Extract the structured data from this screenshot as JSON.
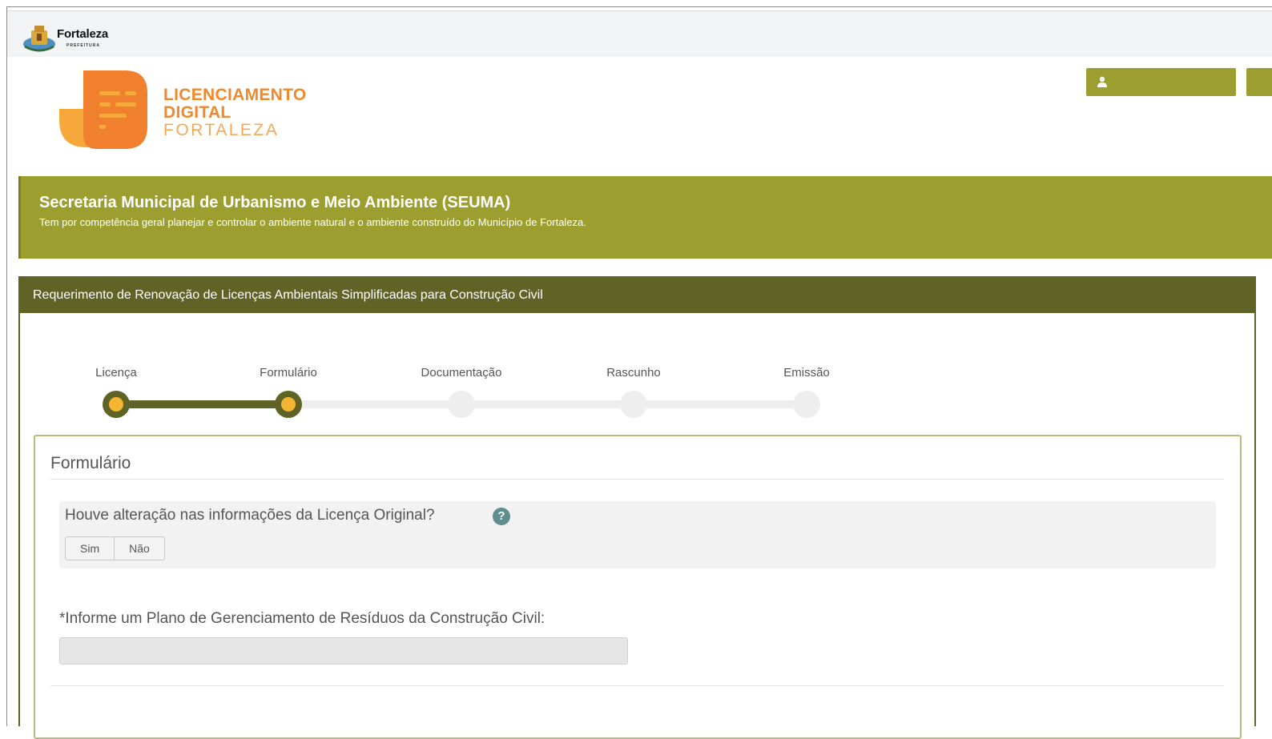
{
  "header": {
    "city_name": "Fortaleza",
    "city_subtitle": "PREFEITURA",
    "brand_line1": "LICENCIAMENTO",
    "brand_line2": "DIGITAL",
    "brand_line3": "FORTALEZA",
    "user_button_label": "",
    "extra_button_label": ""
  },
  "banner": {
    "title": "Secretaria Municipal de Urbanismo e Meio Ambiente (SEUMA)",
    "subtitle": "Tem por competência geral planejar e controlar o ambiente natural e o ambiente construído do Município de Fortaleza."
  },
  "panel": {
    "title": "Requerimento de Renovação de Licenças Ambientais Simplificadas para Construção Civil"
  },
  "steps": [
    {
      "label": "Licença",
      "status": "done"
    },
    {
      "label": "Formulário",
      "status": "current"
    },
    {
      "label": "Documentação",
      "status": "pending"
    },
    {
      "label": "Rascunho",
      "status": "pending"
    },
    {
      "label": "Emissão",
      "status": "pending"
    }
  ],
  "form": {
    "heading": "Formulário",
    "question": "Houve alteração nas informações da Licença Original?",
    "help_icon_glyph": "?",
    "option_yes": "Sim",
    "option_no": "Não",
    "field_label": "*Informe um Plano de Gerenciamento de Resíduos da Construção Civil:",
    "field_value": "",
    "field_placeholder": ""
  },
  "colors": {
    "olive": "#9c9f30",
    "dark_olive": "#5f6326",
    "orange": "#f0892e",
    "yellow": "#f4b533"
  }
}
